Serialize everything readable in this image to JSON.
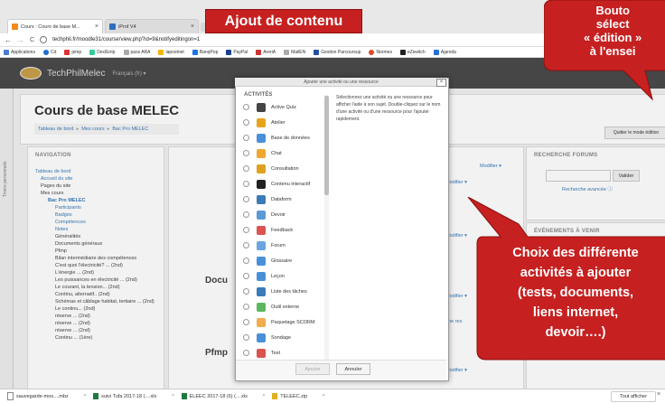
{
  "browser": {
    "tabs": [
      {
        "label": "Cours : Cours de base M...",
        "close": "×"
      },
      {
        "label": "iProf V4",
        "close": "×"
      }
    ],
    "nav_back": "←",
    "nav_forward": "→",
    "reload": "C",
    "url": "techphil.fr/moodle31/course/view.php?id=9&notifyeditingon=1",
    "bookmarks": [
      "Applications",
      "Cd",
      "pimp",
      "DeclEntp",
      "pass ARA",
      "lapostnet",
      "BanqPop",
      "PayPal",
      "AreriA",
      "MailEN",
      "Gestion Parcoursup",
      "Normes",
      "eZswitch",
      "Agenda"
    ]
  },
  "moodle": {
    "site_name": "TechPhilMelec",
    "language": "Français (fr) ▾",
    "side_tab": "Tiroirs personnels",
    "course_title": "Cours de base MELEC",
    "breadcrumb": [
      "Tableau de bord",
      "Mes cours",
      "Bac Pro MELEC"
    ],
    "breadcrumb_sep": "▸",
    "edit_mode_button": "Quitter le mode édition",
    "navigation": {
      "title": "NAVIGATION",
      "items": [
        "Tableau de bord",
        "Accueil du site",
        "Pages du site",
        "Mes cours",
        "Bac Pro MELEC",
        "Participants",
        "Badges",
        "Compétences",
        "Notes",
        "Généralités",
        "Documents généraux",
        "Pfmp",
        "Bilan intermédiaire des compétences",
        "C'est quoi l'électricité? ... (2nd)",
        "L'énergie ... (2nd)",
        "Les puissances en électricité ... (2nd)",
        "Le courant, la tension... (2nd)",
        "Continu, alternatif.. (2nd)",
        "Schémas et câblage habitat, tertiaire ... (2nd)",
        "Le continu... (2nd)",
        "réserve ... (2nd)",
        "réserve ... (2nd)",
        "réserve ... (2nd)",
        "Continu ... (1ère)"
      ]
    },
    "center": {
      "sections": [
        "Docu",
        "Pfmp"
      ],
      "modifier": "Modifier ▾",
      "add_link": "+ Ajouter une ac",
      "add_link2": "une res"
    },
    "forum_block": {
      "title": "RECHERCHE FORUMS",
      "button": "Valider",
      "advanced": "Recherche avancée ⓘ"
    },
    "right_block2_title": "ÉVÉNEMENTS À VENIR"
  },
  "modal": {
    "title": "Ajouter une activité ou une ressource",
    "close": "×",
    "section_title": "ACTIVITÉS",
    "description": "Sélectionnez une activité ou une ressource pour afficher l'aide à son sujet. Double-cliquez sur le nom d'une activité ou d'une ressource pour l'ajouter rapidement.",
    "activities": [
      {
        "label": "Active Quiz",
        "icon": "list-icon",
        "color": "#444"
      },
      {
        "label": "Atelier",
        "icon": "workshop-icon",
        "color": "#e8a31c"
      },
      {
        "label": "Base de données",
        "icon": "database-icon",
        "color": "#4a90d9"
      },
      {
        "label": "Chat",
        "icon": "chat-icon",
        "color": "#f0a830"
      },
      {
        "label": "Consultation",
        "icon": "chart-icon",
        "color": "#e0a020"
      },
      {
        "label": "Contenu interactif",
        "icon": "h5p-icon",
        "color": "#222"
      },
      {
        "label": "Dataform",
        "icon": "form-icon",
        "color": "#3a7bb8"
      },
      {
        "label": "Devoir",
        "icon": "assignment-icon",
        "color": "#5a9ad6"
      },
      {
        "label": "Feedback",
        "icon": "feedback-icon",
        "color": "#d9534f"
      },
      {
        "label": "Forum",
        "icon": "forum-icon",
        "color": "#6aa5e0"
      },
      {
        "label": "Glossaire",
        "icon": "glossary-icon",
        "color": "#4a90d9"
      },
      {
        "label": "Leçon",
        "icon": "lesson-icon",
        "color": "#4a90d9"
      },
      {
        "label": "Liste des tâches",
        "icon": "checklist-icon",
        "color": "#3a7bb8"
      },
      {
        "label": "Outil externe",
        "icon": "puzzle-icon",
        "color": "#5cb85c"
      },
      {
        "label": "Paquetage SCORM",
        "icon": "scorm-icon",
        "color": "#f0ad4e"
      },
      {
        "label": "Sondage",
        "icon": "survey-icon",
        "color": "#4a90d9"
      },
      {
        "label": "Test",
        "icon": "quiz-icon",
        "color": "#d9534f"
      }
    ],
    "add_button": "Ajouter",
    "cancel_button": "Annuler"
  },
  "annotations": {
    "banner": "Ajout de contenu",
    "callout_top_lines": [
      "Bouto",
      "sélect",
      "« édition »",
      "à l'ensei"
    ],
    "callout_bottom_lines": [
      "Choix des différente",
      "activités à ajouter",
      "(tests, documents,",
      "liens internet,",
      "devoir….)"
    ],
    "callout_color": "#c62020"
  },
  "downloads": {
    "items": [
      "sauvegarde-moo....mbz",
      "suivi Tufa 2017-18 (....xls",
      "ELEEC 2017-18 (6) (....xls",
      "TELEEC.zip"
    ],
    "show_all": "Tout afficher",
    "close": "×"
  }
}
